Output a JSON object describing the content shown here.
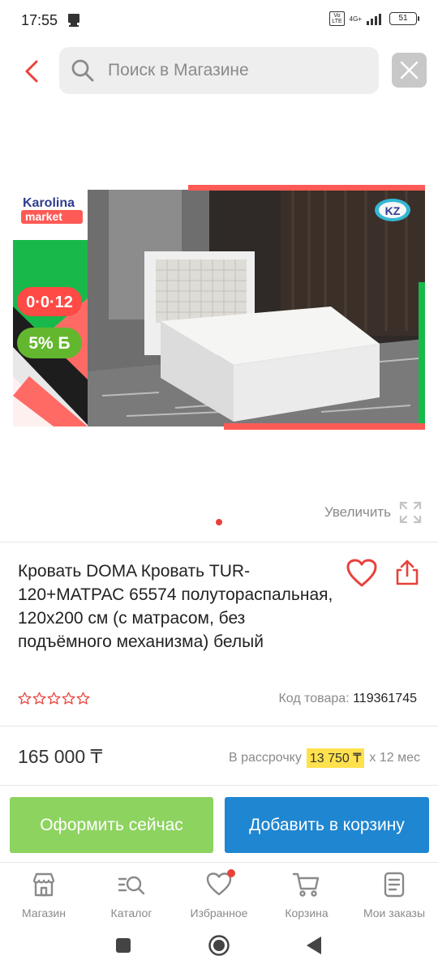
{
  "status": {
    "time": "17:55",
    "volte": "Vo LTE",
    "network": "4G+",
    "battery": "51"
  },
  "search": {
    "placeholder": "Поиск в Магазине"
  },
  "banner": {
    "brand_line1": "Karolina",
    "brand_line2": "market",
    "installment_badge": "0·0·12",
    "bonus_badge": "5% Б",
    "country_badge": "KZ"
  },
  "gallery": {
    "zoom_label": "Увеличить"
  },
  "product": {
    "title": "Кровать DOMA Кровать TUR-120+МАТРАС 65574 полутораспальная, 120x200 см (с матрасом, без подъёмного механизма) белый",
    "code_label": "Код товара:",
    "code_value": "119361745",
    "rating_stars": 5,
    "price": "165 000 ₸",
    "installment_label": "В рассрочку",
    "installment_amount": "13 750 ₸",
    "installment_term": "x 12 мес"
  },
  "actions": {
    "order_label": "Оформить сейчас",
    "cart_label": "Добавить в корзину"
  },
  "nav": [
    {
      "label": "Магазин",
      "icon": "shop-icon"
    },
    {
      "label": "Каталог",
      "icon": "catalog-search-icon"
    },
    {
      "label": "Избранное",
      "icon": "heart-icon"
    },
    {
      "label": "Корзина",
      "icon": "cart-icon"
    },
    {
      "label": "Мои заказы",
      "icon": "orders-icon"
    }
  ],
  "colors": {
    "accent_red": "#e8413b",
    "order_green": "#8dd35f",
    "cart_blue": "#1f86d1",
    "highlight_yellow": "#ffe14d"
  }
}
